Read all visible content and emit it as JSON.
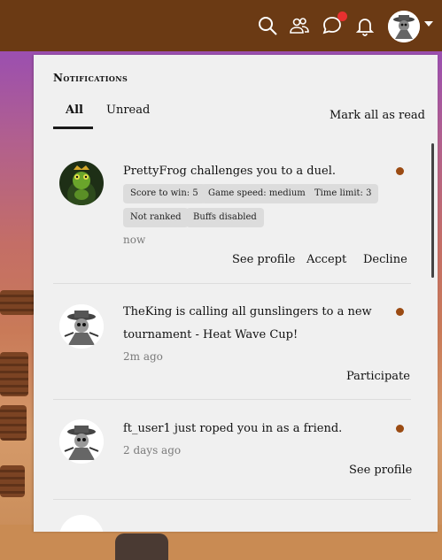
{
  "topbar": {
    "icons": [
      "search-icon",
      "friends-icon",
      "chat-icon",
      "bell-icon"
    ],
    "chat_badge_color": "#e8302f"
  },
  "panel": {
    "title": "Notifications",
    "tabs": [
      {
        "label": "All",
        "active": true
      },
      {
        "label": "Unread",
        "active": false
      }
    ],
    "mark_all_label": "Mark all as read"
  },
  "notifications": [
    {
      "text": "PrettyFrog challenges you to a duel.",
      "tags": [
        "Score to win: 5",
        "Game speed: medium",
        "Time limit: 3",
        "Not ranked",
        "Buffs disabled"
      ],
      "time": "now",
      "actions": [
        "See profile",
        "Accept",
        "Decline"
      ],
      "unread": true
    },
    {
      "text": "TheKing is calling all gunslingers to a new tournament - Heat Wave Cup!",
      "time": "2m ago",
      "actions": [
        "Participate"
      ],
      "unread": true
    },
    {
      "text": "ft_user1 just roped you in as a friend.",
      "time": "2 days ago",
      "actions": [
        "See profile"
      ],
      "unread": true
    }
  ],
  "colors": {
    "topbar": "#6b3a14",
    "panel": "#f0f0f0",
    "unread_dot": "#9b4b13",
    "tag_bg": "#dcdcdc"
  }
}
